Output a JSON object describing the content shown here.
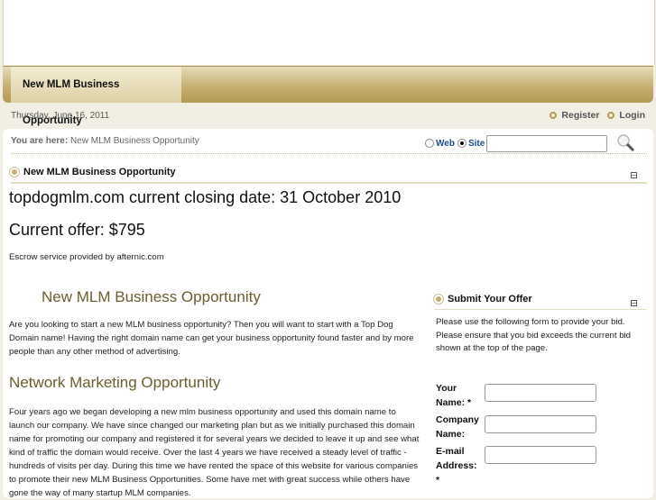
{
  "nav": {
    "tab": "New MLM Business Opportunity"
  },
  "date": "Thursday, June 16, 2011",
  "user_links": {
    "register": "Register",
    "login": "Login"
  },
  "breadcrumb": {
    "label": "You are here:",
    "current": "New MLM Business Opportunity"
  },
  "search": {
    "web": "Web",
    "site": "Site",
    "value": "",
    "selected": "Site"
  },
  "main": {
    "module_title": "New MLM Business Opportunity",
    "closing": "topdogmlm.com current closing date: 31 October 2010",
    "offer": "Current offer: $795",
    "escrow": "Escrow service provided by afternic.com",
    "h1": "New MLM Business Opportunity",
    "p1": "Are you looking to start a new MLM  business opportunity? Then you will want to start with a Top Dog Domain name! Having the right domain name can get your business opportunity found faster and by more people than any other method of advertising.",
    "h2": "Network Marketing Opportunity",
    "p2": "Four years ago we began developing a new mlm business opportunity and used this domain name to launch our company. We have since changed our marketing plan but as we initially purchased this domain name for promoting our company and registered it for several years we decided to leave it up and see what kind of traffic the domain would receive. Over the last 4 years we have received a steady level of traffic - hundreds of visits per day. During this time we have rented the space of this website for various companies to promote their new MLM Business Opportunities. Some have met with great success while others have gone the way of many startup MLM companies."
  },
  "offer_form": {
    "title": "Submit Your Offer",
    "intro": "Please use the following form to provide your bid. Please ensure that you bid exceeds the current bid shown at the top of the page.",
    "fields": [
      {
        "label": "Your Name: *",
        "value": ""
      },
      {
        "label": "Company Name:",
        "value": ""
      },
      {
        "label": "E-mail Address: *",
        "value": ""
      }
    ]
  }
}
